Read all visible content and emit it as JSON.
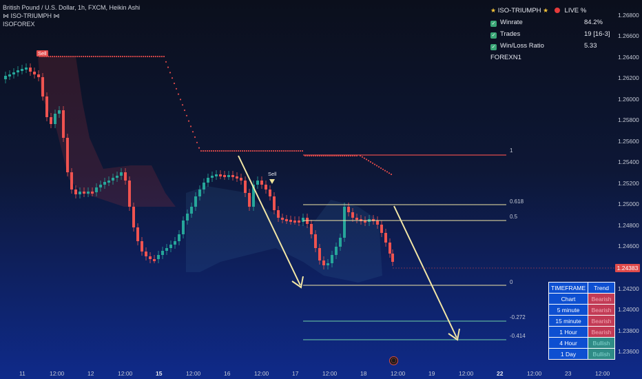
{
  "header": {
    "symbol_line": "British Pound / U.S. Dollar, 1h, FXCM, Heikin Ashi",
    "indicator1": "⋈ ISO-TRIUMPH ⋈",
    "indicator2": "ISOFOREX"
  },
  "stats_panel": {
    "title": "ISO-TRIUMPH",
    "live": "LIVE %",
    "rows": [
      {
        "label": "Winrate",
        "value": "84.2%"
      },
      {
        "label": "Trades",
        "value": "19 [16-3]"
      },
      {
        "label": "Win/Loss Ratio",
        "value": "5.33"
      }
    ],
    "footer": "FOREXN1"
  },
  "price_axis": {
    "ticks": [
      "1.26800",
      "1.26600",
      "1.26400",
      "1.26200",
      "1.26000",
      "1.25800",
      "1.25600",
      "1.25400",
      "1.25200",
      "1.25000",
      "1.24800",
      "1.24600",
      "1.24400",
      "1.24200",
      "1.24000",
      "1.23800",
      "1.23600"
    ],
    "current_price": "1.24383"
  },
  "time_axis": {
    "labels": [
      {
        "text": "11",
        "bold": false
      },
      {
        "text": "12:00",
        "bold": false
      },
      {
        "text": "12",
        "bold": false
      },
      {
        "text": "12:00",
        "bold": false
      },
      {
        "text": "15",
        "bold": true
      },
      {
        "text": "12:00",
        "bold": false
      },
      {
        "text": "16",
        "bold": false
      },
      {
        "text": "12:00",
        "bold": false
      },
      {
        "text": "17",
        "bold": false
      },
      {
        "text": "12:00",
        "bold": false
      },
      {
        "text": "18",
        "bold": false
      },
      {
        "text": "12:00",
        "bold": false
      },
      {
        "text": "19",
        "bold": false
      },
      {
        "text": "12:00",
        "bold": false
      },
      {
        "text": "22",
        "bold": true
      },
      {
        "text": "12:00",
        "bold": false
      },
      {
        "text": "23",
        "bold": false
      },
      {
        "text": "12:00",
        "bold": false
      }
    ]
  },
  "fib_levels": [
    "1",
    "0.618",
    "0.5",
    "0",
    "-0.272",
    "-0.414"
  ],
  "signals": {
    "sell1": "Sell",
    "sell2": "Sell"
  },
  "timeframe_table": {
    "headers": [
      "TIMEFRAME",
      "Trend"
    ],
    "rows": [
      {
        "tf": "Chart",
        "trend": "Bearish",
        "state": "bear"
      },
      {
        "tf": "5 minute",
        "trend": "Bearish",
        "state": "bear"
      },
      {
        "tf": "15 minute",
        "trend": "Bearish",
        "state": "bear"
      },
      {
        "tf": "1 Hour",
        "trend": "Bearish",
        "state": "bear"
      },
      {
        "tf": "4 Hour",
        "trend": "Bullish",
        "state": "bull"
      },
      {
        "tf": "1 Day",
        "trend": "Bullish",
        "state": "bull"
      }
    ]
  },
  "colors": {
    "bull": "#26a69a",
    "bear": "#ef5350",
    "fib_yellow": "#f3e7a6",
    "fib_red": "#e04b4b",
    "fib_green": "#6fd1a8"
  }
}
